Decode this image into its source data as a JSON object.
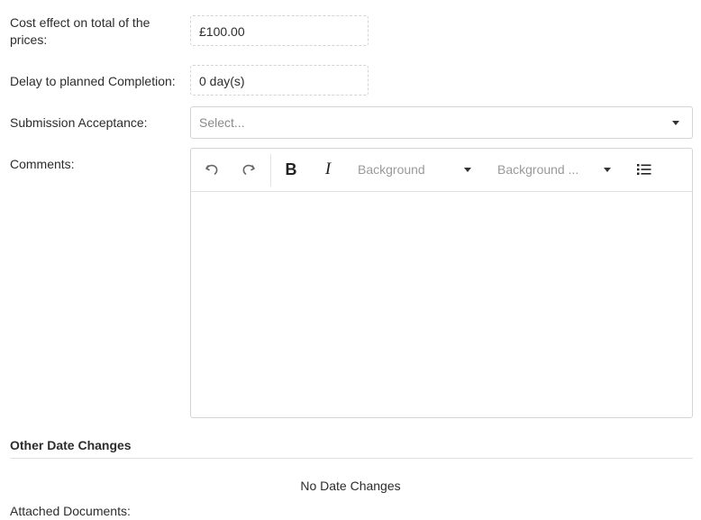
{
  "form": {
    "cost_label": "Cost effect on total of the prices:",
    "cost_value": "£100.00",
    "delay_label": "Delay to planned Completion:",
    "delay_value": "0 day(s)",
    "acceptance_label": "Submission Acceptance:",
    "acceptance_placeholder": "Select...",
    "comments_label": "Comments:"
  },
  "editor_toolbar": {
    "font_color_dropdown": "Background",
    "background_color_dropdown": "Background ..."
  },
  "other_dates": {
    "title": "Other Date Changes",
    "empty_message": "No Date Changes"
  },
  "attachments": {
    "label": "Attached Documents:"
  }
}
